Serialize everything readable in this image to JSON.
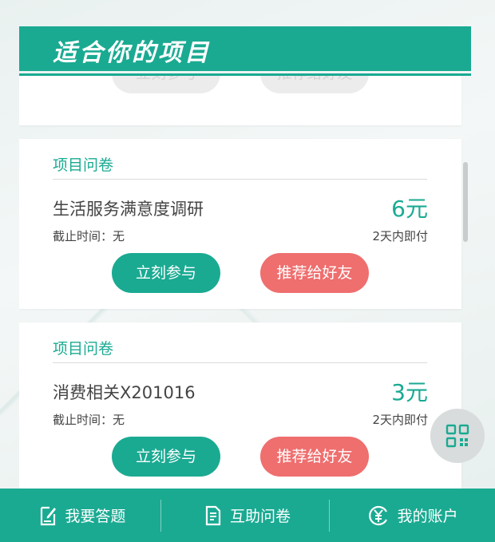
{
  "header": {
    "title": "适合你的项目"
  },
  "prev_card": {
    "join_label": "立刻参与",
    "share_label": "推荐给好友"
  },
  "cards": [
    {
      "category": "项目问卷",
      "title": "生活服务满意度调研",
      "price": "6元",
      "deadline": "截止时间：无",
      "payment": "2天内即付",
      "join_label": "立刻参与",
      "share_label": "推荐给好友"
    },
    {
      "category": "项目问卷",
      "title": "消费相关X201016",
      "price": "3元",
      "deadline": "截止时间：无",
      "payment": "2天内即付",
      "join_label": "立刻参与",
      "share_label": "推荐给好友"
    }
  ],
  "bottom_nav": [
    {
      "label": "我要答题",
      "icon": "edit-document-icon"
    },
    {
      "label": "互助问卷",
      "icon": "survey-document-icon"
    },
    {
      "label": "我的账户",
      "icon": "yuan-account-icon"
    }
  ],
  "colors": {
    "brand": "#1aaa92",
    "accent": "#ef6e6e"
  }
}
